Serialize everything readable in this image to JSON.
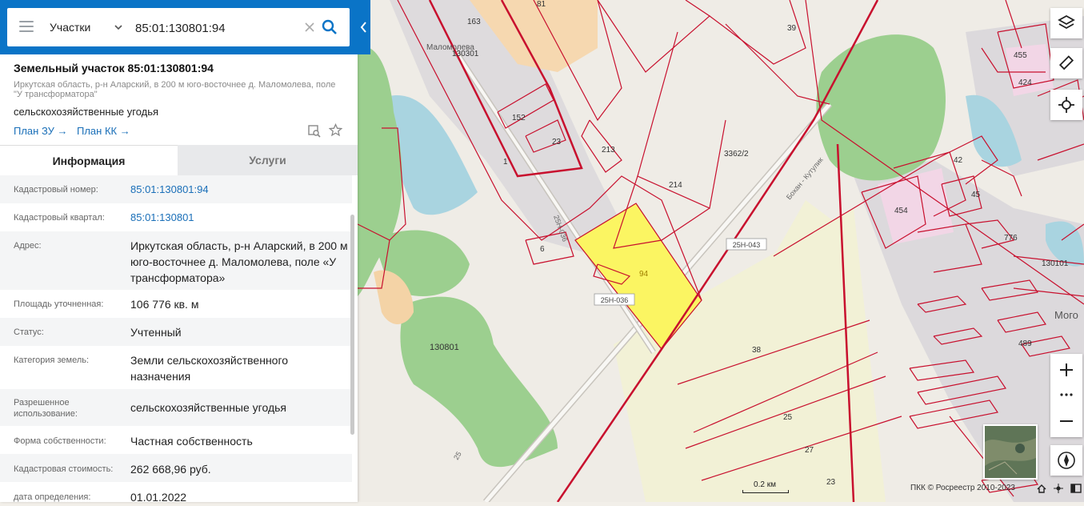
{
  "search": {
    "type": "Участки",
    "value": "85:01:130801:94"
  },
  "header": {
    "title": "Земельный участок 85:01:130801:94",
    "address_small": "Иркутская область, р-н Аларский, в 200 м юго-восточнее д. Маломолева, поле \"У трансформатора\"",
    "subtitle": "сельскохозяйственные угодья",
    "plan_zu": "План ЗУ →",
    "plan_kk": "План КК →"
  },
  "tabs": {
    "info": "Информация",
    "services": "Услуги"
  },
  "info_rows": [
    {
      "label": "Кадастровый номер:",
      "value": "85:01:130801:94"
    },
    {
      "label": "Кадастровый квартал:",
      "value": "85:01:130801"
    },
    {
      "label": "Адрес:",
      "value": "Иркутская область, р-н Аларский, в 200 м юго-восточнее д. Маломолева, поле «У трансформатора»"
    },
    {
      "label": "Площадь уточненная:",
      "value": "106 776 кв. м"
    },
    {
      "label": "Статус:",
      "value": "Учтенный"
    },
    {
      "label": "Категория земель:",
      "value": "Земли сельскохозяйственного назначения"
    },
    {
      "label": "Разрешенное использование:",
      "value": "сельскохозяйственные угодья"
    },
    {
      "label": "Форма собственности:",
      "value": "Частная собственность"
    },
    {
      "label": "Кадастровая стоимость:",
      "value": "262 668,96 руб."
    },
    {
      "label": "дата определения:",
      "value": "01.01.2022"
    }
  ],
  "map": {
    "labels": {
      "l163": "163",
      "l81": "81",
      "l39": "39",
      "l455": "455",
      "l424": "424",
      "l130301": "130301",
      "l152": "152",
      "l23": "23",
      "l1": "1",
      "l213": "213",
      "l3362": "3362/2",
      "l214": "214",
      "l42": "42",
      "l45": "45",
      "l454": "454",
      "l776": "776",
      "l130101": "130101",
      "l6": "6",
      "l94": "94",
      "l38": "38",
      "l130801": "130801",
      "l489": "489",
      "l25": "25",
      "l27": "27",
      "l23b": "23",
      "village": "Маломолева",
      "mogo": "Мого",
      "road1": "25Н-043",
      "road2": "25Н-036",
      "road3": "25Н-036",
      "road_diag": "Бохан - Кутулик",
      "road_left": "25"
    },
    "scale_label": "0.2 км",
    "copyright": "ПКК © Росреестр 2010-2023",
    "colors": {
      "parcel_border": "#c8102e",
      "selected_fill": "#fbf562",
      "forest": "#9ccf8f",
      "water": "#a9d4e0",
      "field": "#f1f0d4",
      "built": "#dcd9dc"
    }
  }
}
